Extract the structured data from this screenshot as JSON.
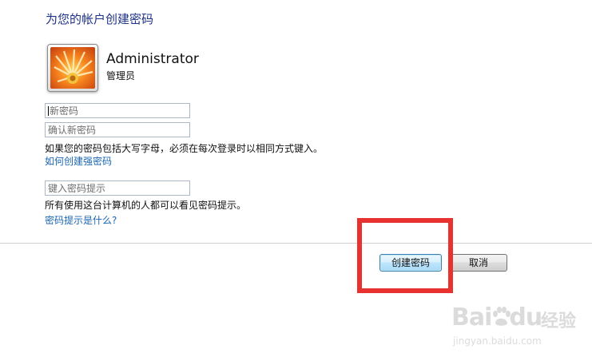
{
  "header": {
    "title": "为您的帐户创建密码"
  },
  "user": {
    "name": "Administrator",
    "role": "管理员"
  },
  "form": {
    "new_password_placeholder": "新密码",
    "confirm_password_placeholder": "确认新密码",
    "caps_note": "如果您的密码包括大写字母，必须在每次登录时以相同方式键入。",
    "strong_password_link": "如何创建强密码",
    "hint_placeholder": "键入密码提示",
    "hint_note": "所有使用这台计算机的人都可以看见密码提示。",
    "hint_help_link": "密码提示是什么?"
  },
  "buttons": {
    "create": "创建密码",
    "cancel": "取消"
  },
  "annotation": {
    "highlight_color": "#e8322f"
  },
  "watermark": {
    "brand": "Bai",
    "brand2": "du",
    "brand_cn": "经验",
    "url": "jingyan.baidu.com"
  },
  "colors": {
    "title": "#1e3287",
    "link": "#1a66b3"
  }
}
